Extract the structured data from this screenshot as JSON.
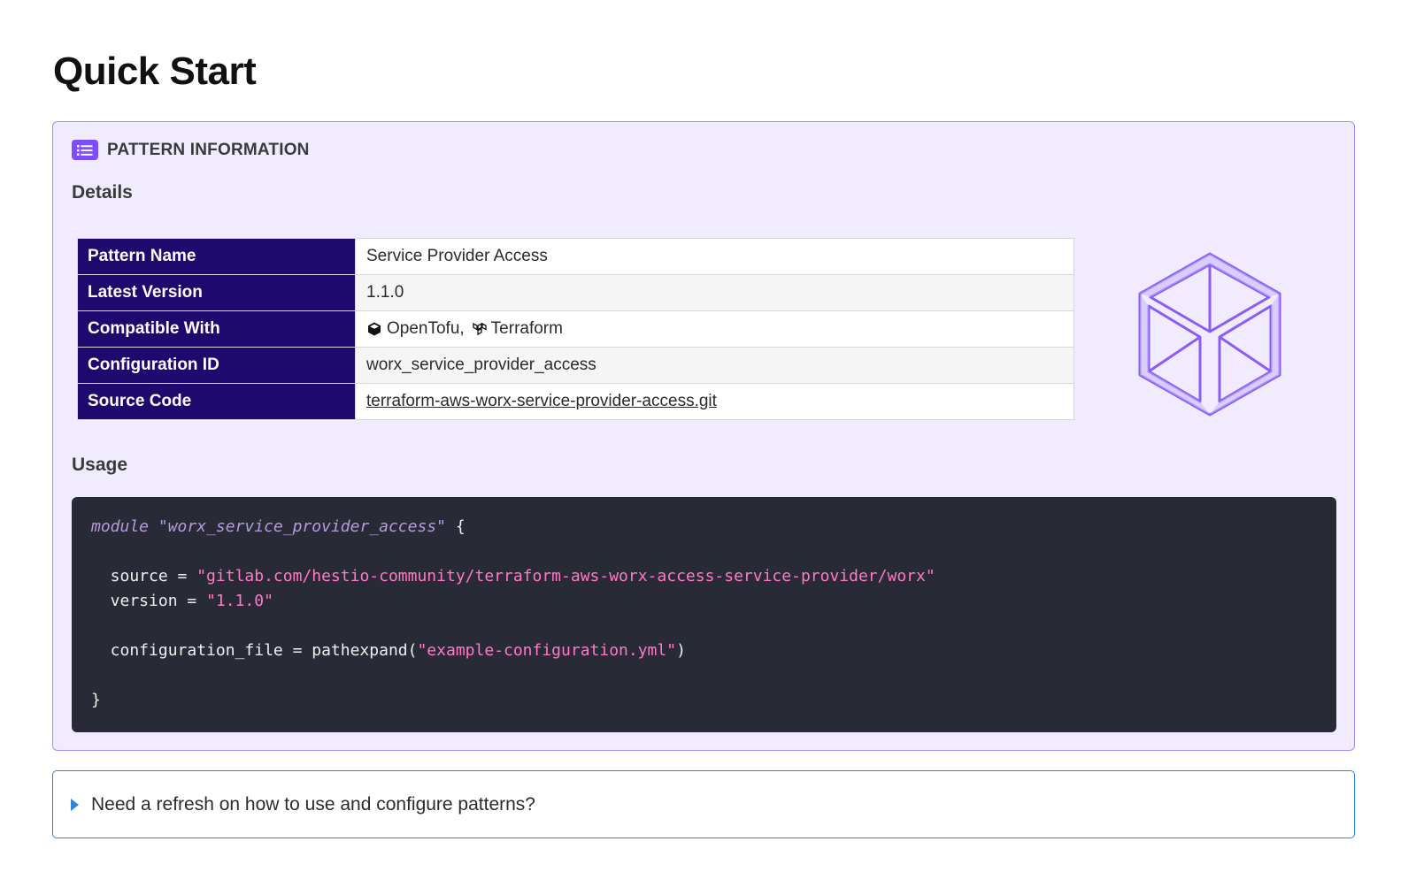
{
  "page": {
    "title": "Quick Start"
  },
  "admonition": {
    "title": "PATTERN INFORMATION",
    "icon": "list-icon",
    "accent_color": "#7c4dff",
    "background_color": "#f1ebff"
  },
  "details": {
    "heading": "Details",
    "rows": [
      {
        "label": "Pattern Name",
        "value": "Service Provider Access"
      },
      {
        "label": "Latest Version",
        "value": "1.1.0"
      },
      {
        "label": "Compatible With",
        "values": [
          "OpenTofu,",
          "Terraform"
        ],
        "icons": [
          "opentofu-icon",
          "terraform-icon"
        ]
      },
      {
        "label": "Configuration ID",
        "value": "worx_service_provider_access"
      },
      {
        "label": "Source Code",
        "value": "terraform-aws-worx-service-provider-access.git"
      }
    ],
    "header_color": "#1e0a6e",
    "graphic": "cube-icon"
  },
  "usage": {
    "heading": "Usage",
    "code": {
      "module_keyword": "module",
      "module_name": "\"worx_service_provider_access\"",
      "open_brace": " {",
      "source_key": "  source = ",
      "source_value": "\"gitlab.com/hestio-community/terraform-aws-worx-access-service-provider/worx\"",
      "version_key": "  version = ",
      "version_value": "\"1.1.0\"",
      "config_key": "  configuration_file = pathexpand(",
      "config_value": "\"example-configuration.yml\"",
      "config_close": ")",
      "close_brace": "}"
    }
  },
  "collapsible": {
    "label": "Need a refresh on how to use and configure patterns?",
    "border_color": "#2f86d6"
  }
}
